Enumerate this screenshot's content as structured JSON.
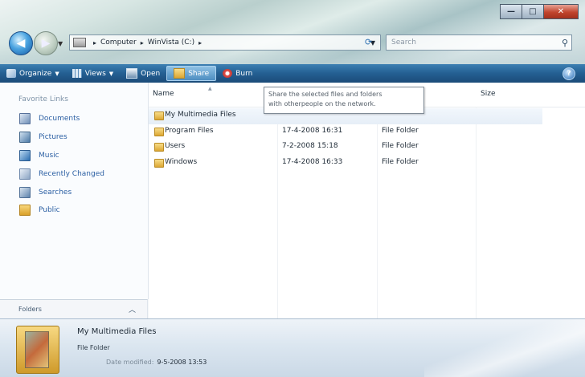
{
  "window": {
    "controls": {
      "minimize": "—",
      "maximize": "□",
      "close": "✕"
    }
  },
  "address": {
    "crumbs": [
      "Computer",
      "WinVista (C:)"
    ],
    "search_placeholder": "Search"
  },
  "toolbar": {
    "organize": "Organize",
    "views": "Views",
    "open": "Open",
    "share": "Share",
    "burn": "Burn",
    "help": "?"
  },
  "tooltip": {
    "line1": "Share the selected files and folders",
    "line2": "with otherpeople on the network."
  },
  "nav": {
    "title": "Favorite Links",
    "items": [
      {
        "label": "Documents",
        "icon": "documents-icon"
      },
      {
        "label": "Pictures",
        "icon": "pictures-icon"
      },
      {
        "label": "Music",
        "icon": "music-icon"
      },
      {
        "label": "Recently Changed",
        "icon": "recently-changed-icon"
      },
      {
        "label": "Searches",
        "icon": "searches-icon"
      },
      {
        "label": "Public",
        "icon": "public-folder-icon"
      }
    ],
    "folders_label": "Folders"
  },
  "columns": {
    "name": "Name",
    "date": "",
    "type": "",
    "size": "Size"
  },
  "files": [
    {
      "name": "My Multimedia Files",
      "date": "",
      "type": ""
    },
    {
      "name": "Program Files",
      "date": "17-4-2008 16:31",
      "type": "File Folder"
    },
    {
      "name": "Users",
      "date": "7-2-2008 15:18",
      "type": "File Folder"
    },
    {
      "name": "Windows",
      "date": "17-4-2008 16:33",
      "type": "File Folder"
    }
  ],
  "details": {
    "name": "My Multimedia Files",
    "type": "File Folder",
    "modified_label": "Date modified:",
    "modified_value": "9-5-2008 13:53"
  },
  "colors": {
    "toolbar": "#245f92",
    "link": "#2b5fa3"
  }
}
